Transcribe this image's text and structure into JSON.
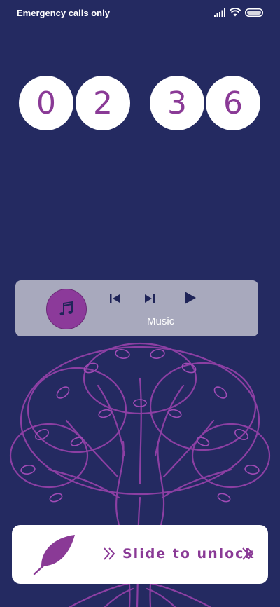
{
  "status_bar": {
    "carrier_text": "Emergency calls only",
    "icons": [
      "signal-icon",
      "wifi-icon",
      "battery-icon"
    ]
  },
  "clock": {
    "digits": [
      "0",
      "2",
      "3",
      "6"
    ]
  },
  "music": {
    "label": "Music",
    "icons": [
      "music-note-icon",
      "previous-icon",
      "next-icon",
      "play-icon"
    ]
  },
  "unlock": {
    "label": "Slide to unlock",
    "icon": "leaf-icon"
  },
  "colors": {
    "background": "#242a61",
    "accent": "#8a3a96",
    "card": "#a8a9bd"
  }
}
